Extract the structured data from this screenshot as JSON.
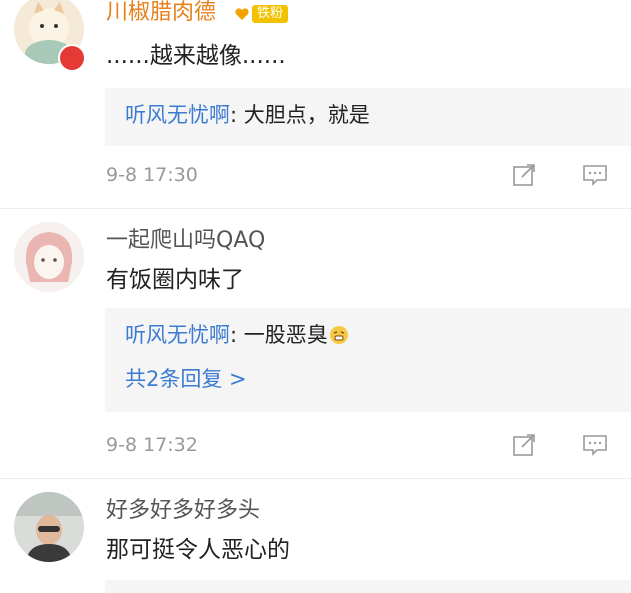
{
  "comments": [
    {
      "username": "川椒腊肉德",
      "badge_text": "铁粉",
      "text": "......越来越像......",
      "replies": [
        {
          "author": "听风无忧啊",
          "text": ": 大胆点，就是"
        }
      ],
      "more_replies": "",
      "time": "9-8 17:30"
    },
    {
      "username": "一起爬山吗QAQ",
      "text": "有饭圈内味了",
      "replies": [
        {
          "author": "听风无忧啊",
          "text": ": 一股恶臭"
        }
      ],
      "more_replies": "共2条回复 >",
      "time": "9-8 17:32"
    },
    {
      "username": "好多好多好多头",
      "text": "那可挺令人恶心的"
    }
  ],
  "icons": {
    "share": "share-icon",
    "comment": "comment-icon",
    "emoji": "persevere-emoji-icon"
  },
  "colors": {
    "username_vip": "#e8801c",
    "link_blue": "#3b7bd1",
    "meta_gray": "#999999",
    "reply_bg": "#f5f5f5",
    "badge": "#f2c200"
  }
}
